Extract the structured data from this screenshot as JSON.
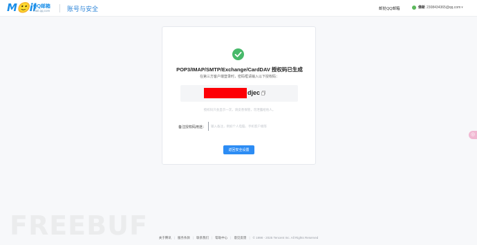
{
  "header": {
    "logo_text": "M🙂il",
    "logo_qq": "QQ邮箱",
    "logo_domain": "mail.qq.com",
    "section_title": "账号与安全",
    "tip_link": "邮处QQ邮箱",
    "account_name": "佛新",
    "account_email": "2308434365@qq.com"
  },
  "card": {
    "title": "POP3/IMAP/SMTP/Exchange/CardDAV 授权码已生成",
    "description": "在第三方客户端登录时，密码框请输入以下授权码：",
    "code_suffix": "djec",
    "code_hint": "授权码只会显示一次，请妥善保管，勿泄露给他人。",
    "remark_label": "备注授权码用途：",
    "remark_placeholder": "输入备注，例如个人电脑、手机客户端等",
    "back_button_label": "返回安全设置"
  },
  "side_bubble": {
    "label": "◎"
  },
  "watermark": "FREEBUF",
  "footer": {
    "links": [
      "关于腾讯",
      "服务条款",
      "联系我们",
      "帮助中心",
      "意见反馈"
    ],
    "copyright": "© 1998 - 2025 Tencent Inc. All Rights Reserved"
  },
  "colors": {
    "accent": "#2c8cf4",
    "success": "#47b96a",
    "redaction": "#fd0006"
  }
}
